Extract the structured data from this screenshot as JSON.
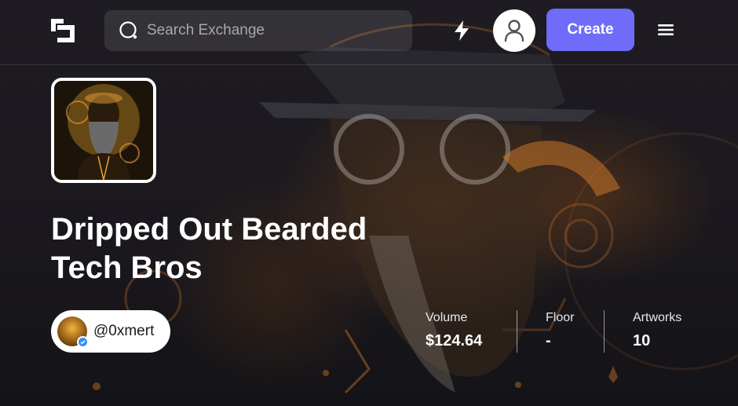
{
  "header": {
    "search": {
      "placeholder": "Search Exchange",
      "value": ""
    },
    "create_label": "Create",
    "icons": {
      "logo": "logo-icon",
      "search": "search-icon",
      "activity": "bolt-icon",
      "profile": "user-icon",
      "menu": "hamburger-menu-icon"
    }
  },
  "collection": {
    "title": "Dripped Out Bearded Tech Bros",
    "creator": {
      "handle": "@0xmert",
      "verified": true
    },
    "stats": [
      {
        "label": "Volume",
        "value": "$124.64"
      },
      {
        "label": "Floor",
        "value": "-"
      },
      {
        "label": "Artworks",
        "value": "10"
      }
    ]
  },
  "colors": {
    "accent": "#6e6cf8",
    "background": "#17161c",
    "art_orange": "#c8772a"
  }
}
